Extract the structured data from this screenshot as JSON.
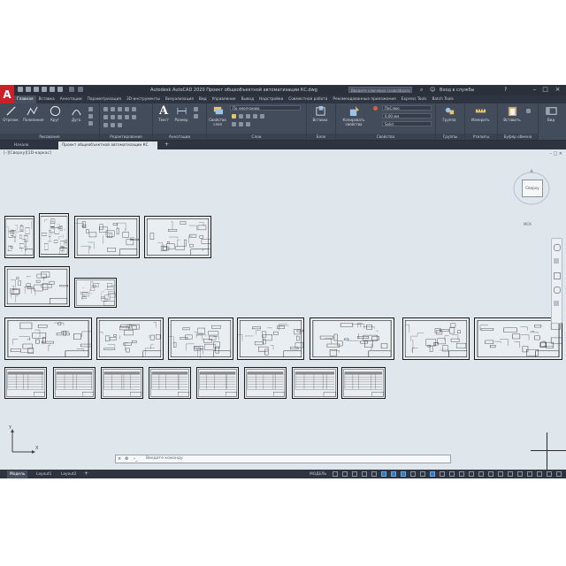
{
  "app": {
    "logo": "A",
    "title": "Autodesk AutoCAD 2020   Проект общеобъектной автоматизации КС.dwg",
    "search_placeholder": "Введите ключевое слово/фразу",
    "sign_in": "Вход в службы",
    "window_buttons": [
      "–",
      "□",
      "×"
    ]
  },
  "ribbon_tabs": [
    "Главная",
    "Вставка",
    "Аннотации",
    "Параметризация",
    "3D-инструменты",
    "Визуализация",
    "Вид",
    "Управление",
    "Вывод",
    "Надстройки",
    "Совместная работа",
    "Рекомендованные приложения",
    "Express Tools",
    "Batch Tools"
  ],
  "ribbon_panels": {
    "draw": {
      "label": "Рисование",
      "tools": [
        "Отрезок",
        "Полилиния",
        "Круг",
        "Дуга"
      ]
    },
    "modify": {
      "label": "Редактирование"
    },
    "annotations": {
      "label": "Аннотации",
      "tools": [
        "Текст",
        "Размер"
      ]
    },
    "layers": {
      "label": "Слои",
      "tools": [
        "Свойства слоя"
      ],
      "current_layer": "По умолчанию"
    },
    "block": {
      "label": "Блок",
      "tools": [
        "Вставка"
      ]
    },
    "properties": {
      "label": "Свойства",
      "tools": [
        "Копировать свойства"
      ],
      "color": "ПоСлою",
      "lineweight": "0.00 мм",
      "linetype": "Solid"
    },
    "groups": {
      "label": "Группы",
      "tools": [
        "Группа"
      ]
    },
    "utilities": {
      "label": "Утилиты",
      "tools": [
        "Измерить"
      ]
    },
    "clipboard": {
      "label": "Буфер обмена",
      "tools": [
        "Вставить"
      ]
    },
    "view": {
      "label": "Вид",
      "tools": [
        "Вид"
      ]
    }
  },
  "file_tabs": [
    "Начало",
    "Проект общеобъектной автоматизации КС"
  ],
  "canvas": {
    "view_label": "[–][Сверху][2D-каркас]",
    "viewcube_face": "Сверху",
    "wcs_label": "МСК",
    "command_placeholder": "Введите команду"
  },
  "status": {
    "layouts": [
      "Модель",
      "Layout1",
      "Layout2"
    ],
    "model_label": "МОДЕЛЬ"
  },
  "colors": {
    "accent": "#3a78b5",
    "logo": "#c9202a",
    "canvas": "#dfe6ec",
    "chrome": "#3b4453"
  },
  "icons": [
    "search-icon",
    "user-icon",
    "help-icon",
    "layer-icon",
    "text-icon",
    "dimension-icon",
    "gear-icon"
  ]
}
